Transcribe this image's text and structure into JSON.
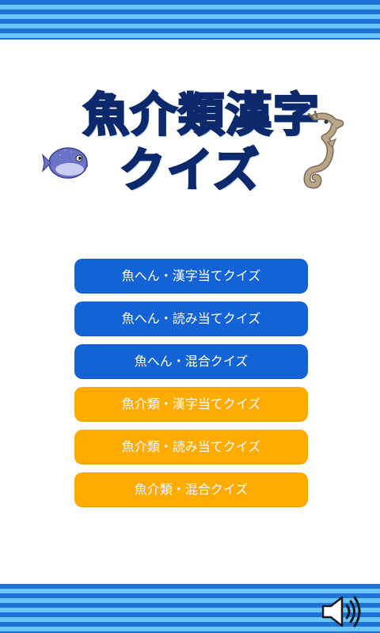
{
  "title": {
    "line1": "魚介類漢字",
    "line2": "クイズ"
  },
  "decorations": {
    "left_icon": "pufferfish-icon",
    "right_icon": "seahorse-icon"
  },
  "menu": {
    "items": [
      {
        "label": "魚へん・漢字当てクイズ",
        "color": "#1463d6"
      },
      {
        "label": "魚へん・読み当てクイズ",
        "color": "#1463d6"
      },
      {
        "label": "魚へん・混合クイズ",
        "color": "#1463d6"
      },
      {
        "label": "魚介類・漢字当てクイズ",
        "color": "#ffab00"
      },
      {
        "label": "魚介類・読み当てクイズ",
        "color": "#ffab00"
      },
      {
        "label": "魚介類・混合クイズ",
        "color": "#ffab00"
      }
    ]
  },
  "footer": {
    "sound_icon": "speaker-icon"
  },
  "colors": {
    "stripe_dark": "#1e73d8",
    "stripe_light": "#69c3ff",
    "title": "#1d4aa8"
  }
}
